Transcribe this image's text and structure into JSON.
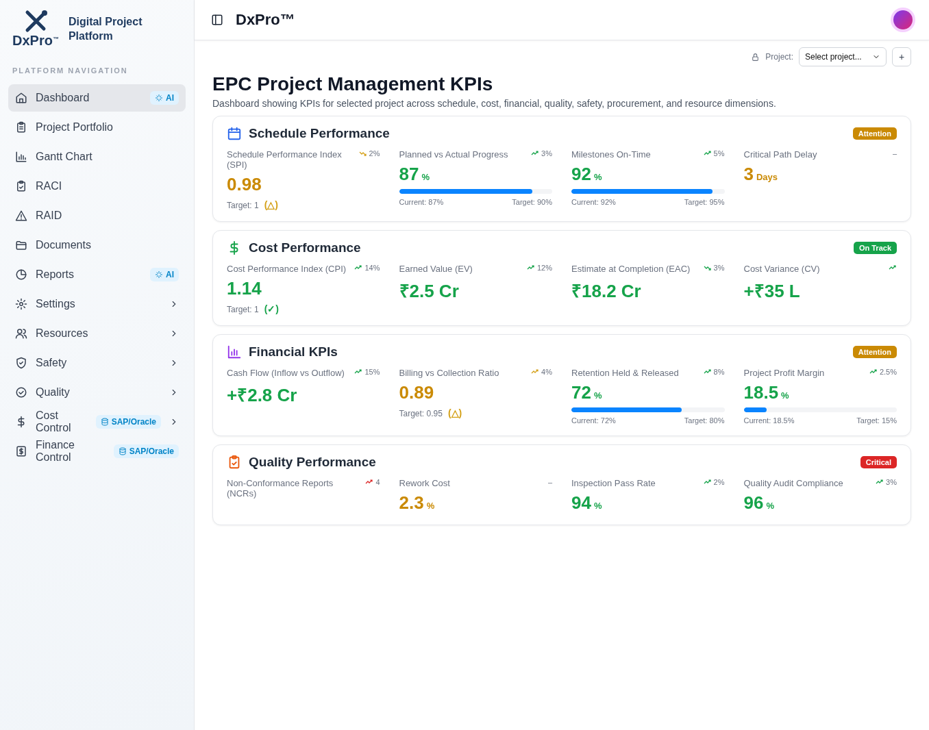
{
  "brand": {
    "logo_text": "DxPro",
    "logo_mark": "™",
    "platform_name": "Digital Project Platform"
  },
  "sidebar": {
    "section_title": "PLATFORM NAVIGATION",
    "items": [
      {
        "label": "Dashboard",
        "selected": true,
        "expandable": false,
        "badge": {
          "kind": "ai",
          "text": "AI"
        }
      },
      {
        "label": "Project Portfolio",
        "selected": false,
        "expandable": false
      },
      {
        "label": "Gantt Chart",
        "selected": false,
        "expandable": false
      },
      {
        "label": "RACI",
        "selected": false,
        "expandable": false
      },
      {
        "label": "RAID",
        "selected": false,
        "expandable": false
      },
      {
        "label": "Documents",
        "selected": false,
        "expandable": false
      },
      {
        "label": "Reports",
        "selected": false,
        "expandable": false,
        "badge": {
          "kind": "ai",
          "text": "AI"
        }
      },
      {
        "label": "Settings",
        "selected": false,
        "expandable": true
      },
      {
        "label": "Resources",
        "selected": false,
        "expandable": true
      },
      {
        "label": "Safety",
        "selected": false,
        "expandable": true
      },
      {
        "label": "Quality",
        "selected": false,
        "expandable": true
      },
      {
        "label": "Cost Control",
        "selected": false,
        "expandable": true,
        "badge": {
          "kind": "integration",
          "text": "SAP/Oracle"
        }
      },
      {
        "label": "Finance Control",
        "selected": false,
        "expandable": false,
        "badge": {
          "kind": "integration",
          "text": "SAP/Oracle"
        }
      }
    ]
  },
  "header": {
    "app_title": "DxPro™"
  },
  "project_picker": {
    "label": "Project:",
    "placeholder": "Select project...",
    "add_button": "+"
  },
  "page": {
    "title": "EPC Project Management KPIs",
    "subtitle": "Dashboard showing KPIs for selected project across schedule, cost, financial, quality, safety, procurement, and resource dimensions."
  },
  "cards": [
    {
      "title": "Schedule Performance",
      "status": {
        "color": "#ca8a04",
        "text": "Attention"
      },
      "metrics": [
        {
          "label": "Schedule Performance Index (SPI)",
          "value": "0.98",
          "color": "#ca8a04",
          "trend": {
            "kind": "down",
            "color": "#d4a017",
            "text": "2%"
          },
          "target": {
            "text": "Target: 1",
            "mark": "(△)",
            "color": "#d4a017"
          }
        },
        {
          "label": "Planned vs Actual Progress",
          "value": "87",
          "unit": "%",
          "color": "#16a34a",
          "trend": {
            "kind": "up",
            "color": "#16a34a",
            "text": "3%"
          },
          "bar": {
            "level": 0.87,
            "current": "Current: 87%",
            "target": "Target: 90%"
          }
        },
        {
          "label": "Milestones On-Time",
          "value": "92",
          "unit": "%",
          "color": "#16a34a",
          "trend": {
            "kind": "up",
            "color": "#16a34a",
            "text": "5%"
          },
          "bar": {
            "level": 0.92,
            "current": "Current: 92%",
            "target": "Target: 95%"
          }
        },
        {
          "label": "Critical Path Delay",
          "value": "3",
          "unit": "Days",
          "color": "#ca8a04",
          "trend": {
            "kind": "flat",
            "text": "–"
          }
        }
      ]
    },
    {
      "title": "Cost Performance",
      "status": {
        "color": "#16a34a",
        "text": "On Track"
      },
      "metrics": [
        {
          "label": "Cost Performance Index (CPI)",
          "value": "1.14",
          "color": "#16a34a",
          "trend": {
            "kind": "up",
            "color": "#16a34a",
            "text": "14%"
          },
          "target": {
            "text": "Target: 1",
            "mark": "(✓)",
            "color": "#16a34a"
          }
        },
        {
          "label": "Earned Value (EV)",
          "value": "₹2.5 Cr",
          "color": "#16a34a",
          "trend": {
            "kind": "up",
            "color": "#16a34a",
            "text": "12%"
          }
        },
        {
          "label": "Estimate at Completion (EAC)",
          "value": "₹18.2 Cr",
          "color": "#16a34a",
          "trend": {
            "kind": "down",
            "color": "#16a34a",
            "text": "3%"
          }
        },
        {
          "label": "Cost Variance (CV)",
          "value": "+₹35 L",
          "color": "#16a34a",
          "trend": {
            "kind": "up",
            "color": "#16a34a"
          }
        }
      ]
    },
    {
      "title": "Financial KPIs",
      "status": {
        "color": "#ca8a04",
        "text": "Attention"
      },
      "metrics": [
        {
          "label": "Cash Flow (Inflow vs Outflow)",
          "value": "+₹2.8 Cr",
          "color": "#16a34a",
          "trend": {
            "kind": "up",
            "color": "#16a34a",
            "text": "15%"
          }
        },
        {
          "label": "Billing vs Collection Ratio",
          "value": "0.89",
          "color": "#ca8a04",
          "trend": {
            "kind": "up",
            "color": "#d4a017",
            "text": "4%"
          },
          "target": {
            "text": "Target: 0.95",
            "mark": "(△)",
            "color": "#d4a017"
          }
        },
        {
          "label": "Retention Held & Released",
          "value": "72",
          "unit": "%",
          "color": "#16a34a",
          "trend": {
            "kind": "up",
            "color": "#16a34a",
            "text": "8%"
          },
          "bar": {
            "level": 0.72,
            "current": "Current: 72%",
            "target": "Target: 80%"
          }
        },
        {
          "label": "Project Profit Margin",
          "value": "18.5",
          "unit": "%",
          "color": "#16a34a",
          "trend": {
            "kind": "up",
            "color": "#16a34a",
            "text": "2.5%"
          },
          "bar": {
            "level": 0.15,
            "current": "Current: 18.5%",
            "target": "Target: 15%"
          }
        }
      ]
    },
    {
      "title": "Quality Performance",
      "status": {
        "color": "#dc2626",
        "text": "Critical"
      },
      "metrics": [
        {
          "label": "Non-Conformance Reports (NCRs)",
          "trend": {
            "kind": "up",
            "color": "#dc2626",
            "text": "4"
          }
        },
        {
          "label": "Rework Cost",
          "value": "2.3",
          "unit": "%",
          "color": "#ca8a04",
          "trend": {
            "kind": "flat",
            "text": "–"
          }
        },
        {
          "label": "Inspection Pass Rate",
          "value": "94",
          "unit": "%",
          "color": "#16a34a",
          "trend": {
            "kind": "up",
            "color": "#16a34a",
            "text": "2%"
          }
        },
        {
          "label": "Quality Audit Compliance",
          "value": "96",
          "unit": "%",
          "color": "#16a34a",
          "trend": {
            "kind": "up",
            "color": "#16a34a",
            "text": "3%"
          }
        }
      ]
    }
  ]
}
